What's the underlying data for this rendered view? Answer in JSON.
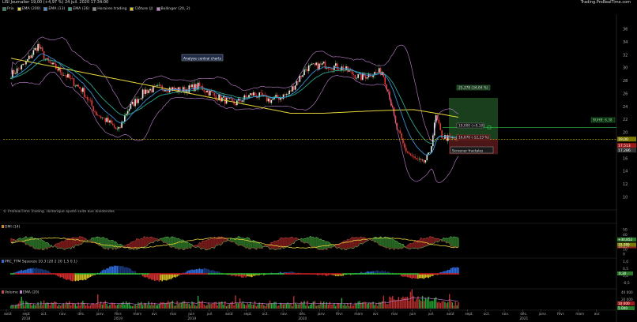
{
  "header": {
    "title": "LISI Journalier 19,00 (+4,97 %) 24 juil. 2020 17:34:00",
    "source": "Trading.ProRealTime.com"
  },
  "price_legend": [
    {
      "label": "Prix",
      "color": "#2e8b57"
    },
    {
      "label": "EMA (200)",
      "color": "#e7d43a"
    },
    {
      "label": "EMA (13)",
      "color": "#3e8fd8"
    },
    {
      "label": "EMA (26)",
      "color": "#2ca58d"
    },
    {
      "label": "Horaires trading",
      "color": "#888888"
    },
    {
      "label": "Clôture (J)",
      "color": "#e0d000"
    },
    {
      "label": "Bollinger (20, 2)",
      "color": "#c585d6"
    }
  ],
  "price_axis": [
    "36",
    "34",
    "32",
    "30",
    "28",
    "26",
    "24",
    "22",
    "20",
    "18",
    "16",
    "14",
    "12",
    "10"
  ],
  "annotations": {
    "analyse": "Analyse central charts",
    "screener": "Screener fractales",
    "target_up": "25,378 (34,04 %)",
    "entry": "19,000 (+0,10)",
    "target_down": "16,670 (-12,23 %)",
    "right_label": "BUHB: 6,38"
  },
  "price_badges": {
    "current": "19,00",
    "red": "17,513",
    "dark": "17,286"
  },
  "footnote": "© ProRealTime Trading. Historique ajusté suite aux dividendes",
  "panels": {
    "dmi": {
      "legend": "DMI (14)",
      "axis": [
        "50",
        "40",
        "30",
        "20",
        "10",
        "0"
      ],
      "badges": [
        "+30,852",
        "16,197",
        "19,389"
      ]
    },
    "ttm": {
      "legend": "PRC_TTM Squeeze 10.3 (20 2 20 1.5 0.1)",
      "axis": [
        "1,0",
        "0,5",
        "0,0",
        "-0,5"
      ],
      "badges": [
        "0,30"
      ]
    },
    "volume": {
      "legend_volume": "Volume",
      "legend_ema": "EMA (20)",
      "axis": [
        "40 000",
        "20 000",
        "0"
      ],
      "badges": [
        "10 000",
        "5 000"
      ]
    }
  },
  "time_axis": {
    "months": [
      "août",
      "sept",
      "oct.",
      "nov.",
      "déc.",
      "janv.",
      "févr.",
      "mars",
      "avr.",
      "mai",
      "juin",
      "juil.",
      "août",
      "sept.",
      "oct.",
      "nov.",
      "déc.",
      "janv.",
      "févr.",
      "mars",
      "avr.",
      "mai",
      "juin",
      "juil.",
      "août",
      "sept.",
      "oct.",
      "nov.",
      "déc.",
      "janv.",
      "févr.",
      "mars",
      "avr."
    ],
    "years": [
      "2018",
      "2019",
      "2019",
      "2020",
      "2021"
    ]
  }
}
